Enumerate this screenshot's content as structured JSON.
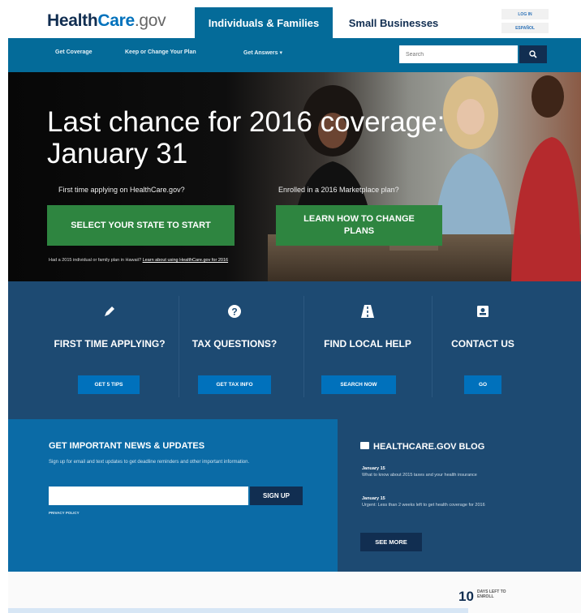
{
  "header": {
    "logo": {
      "health": "Health",
      "care": "Care",
      "gov": ".gov"
    },
    "tabs": [
      "Individuals & Families",
      "Small Businesses"
    ],
    "utility": {
      "login": "LOG IN",
      "spanish": "ESPAÑOL"
    }
  },
  "nav": {
    "items": [
      "Get Coverage",
      "Keep or Change Your Plan",
      "Get Answers  ▾"
    ],
    "search_placeholder": "Search"
  },
  "hero": {
    "headline": "Last chance for 2016 coverage: January 31",
    "first_time_label": "First time applying on HealthCare.gov?",
    "enrolled_label": "Enrolled in a 2016 Marketplace plan?",
    "cta_select_state": "SELECT YOUR STATE TO START",
    "cta_change_plans": "LEARN HOW TO CHANGE PLANS",
    "hawaii_prefix": "Had a 2015 individual or family plan in Hawaii?",
    "hawaii_link": "Learn about using HealthCare.gov for 2016"
  },
  "quick_links": [
    {
      "icon": "pencil-icon",
      "title": "FIRST TIME APPLYING?",
      "button": "GET 5 TIPS"
    },
    {
      "icon": "question-icon",
      "title": "TAX QUESTIONS?",
      "button": "GET TAX INFO"
    },
    {
      "icon": "road-icon",
      "title": "FIND LOCAL HELP",
      "button": "SEARCH NOW"
    },
    {
      "icon": "contact-card-icon",
      "title": "CONTACT US",
      "button": "GO"
    }
  ],
  "news": {
    "title": "GET IMPORTANT NEWS & UPDATES",
    "description": "Sign up for email and text updates to get deadline reminders and other important information.",
    "signup_label": "SIGN UP",
    "privacy": "PRIVACY POLICY"
  },
  "blog": {
    "title": "HEALTHCARE.GOV BLOG",
    "posts": [
      {
        "date": "January 15",
        "text": "What to know about 2015 taxes and your health insurance"
      },
      {
        "date": "January 15",
        "text": "Urgent: Less than 2 weeks left to get health coverage for 2016"
      }
    ],
    "see_more": "SEE MORE"
  },
  "countdown": {
    "number": "10",
    "label": "DAYS LEFT TO ENROLL"
  },
  "colors": {
    "navy": "#112e51",
    "primary_blue": "#046b99",
    "green": "#2e8540",
    "dark_panel": "#1d4a72",
    "news_blue": "#0b6ba6"
  }
}
